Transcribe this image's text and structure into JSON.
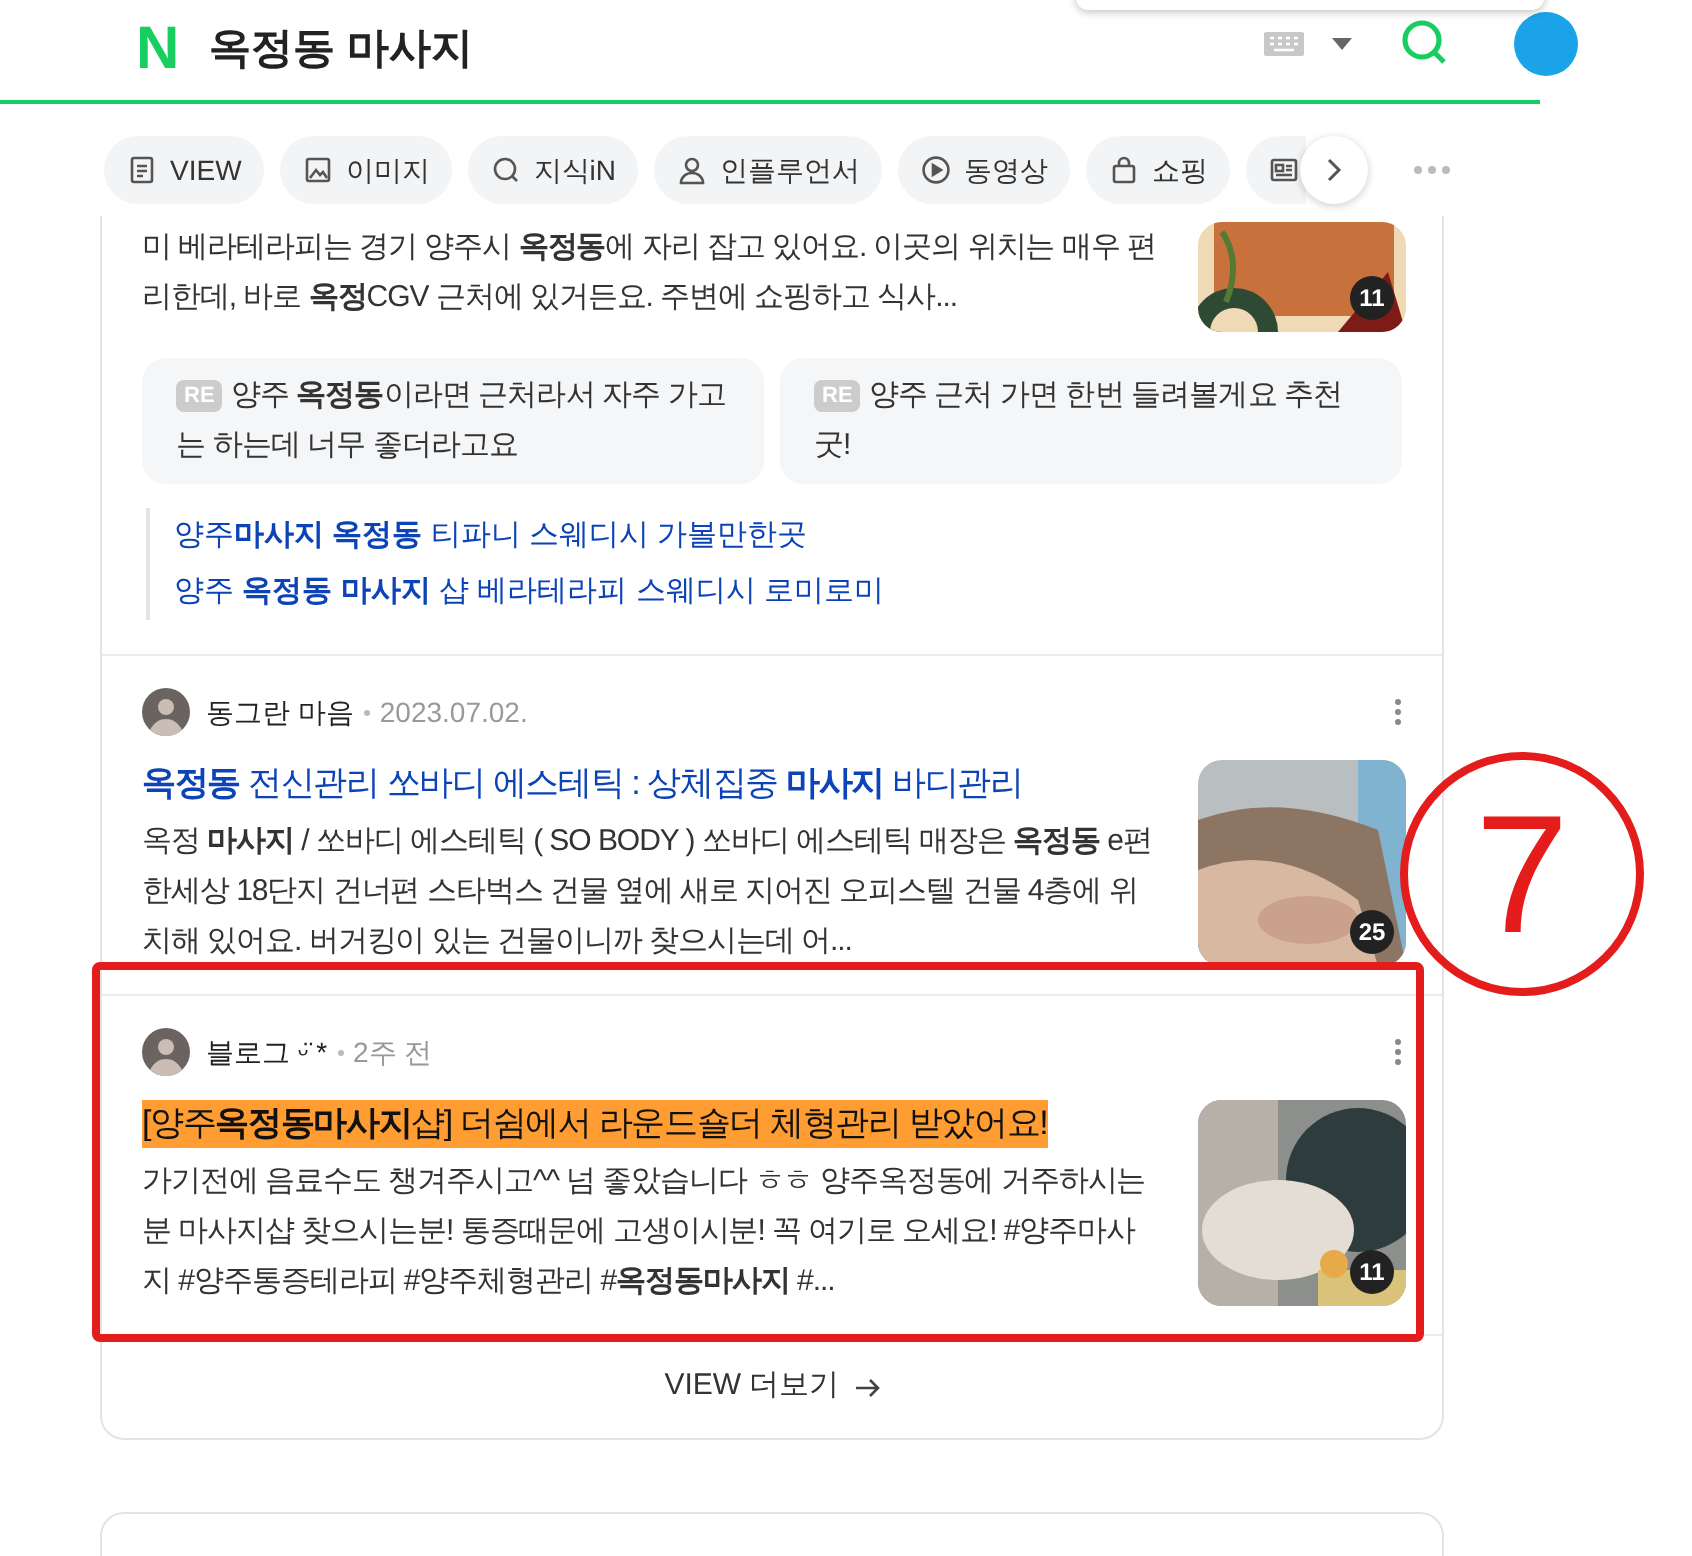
{
  "header": {
    "logo": "N",
    "query": "옥정동 마사지"
  },
  "tabs": [
    {
      "kind": "labeled",
      "label": "VIEW"
    },
    {
      "kind": "labeled",
      "label": "이미지"
    },
    {
      "kind": "labeled",
      "label": "지식iN"
    },
    {
      "kind": "labeled",
      "label": "인플루언서"
    },
    {
      "kind": "labeled",
      "label": "동영상"
    },
    {
      "kind": "labeled",
      "label": "쇼핑"
    },
    {
      "kind": "icon_only"
    }
  ],
  "posts": [
    {
      "snippet": "미 베라테라피는 경기 양주시 **옥정동**에 자리 잡고 있어요. 이곳의 위치는 매우 편리한데, 바로 **옥정**CGV 근처에 있거든요. 주변에 쇼핑하고 식사...",
      "thumb_count": "11",
      "comments": [
        {
          "tag": "RE",
          "text": "양주 **옥정동**이라면 근처라서 자주 가고는 하는데 너무 좋더라고요"
        },
        {
          "tag": "RE",
          "text": "양주 근처 가면 한번 들려볼게요 추천굿!"
        }
      ],
      "related": [
        "양주**마사지 옥정동** 티파니 스웨디시 가볼만한곳",
        "양주 **옥정동 마사지** 샵 베라테라피 스웨디시 로미로미"
      ]
    },
    {
      "author": "동그란 마음",
      "date": "2023.07.02.",
      "title": "**옥정동** 전신관리 쏘바디 에스테틱 : 상체집중 **마사지** 바디관리",
      "highlighted": false,
      "snippet": "옥정 **마사지** / 쏘바디 에스테틱 ( SO BODY ) 쏘바디 에스테틱 매장은 **옥정동** e편한세상 18단지 건너편 스타벅스 건물 옆에 새로 지어진 오피스텔 건물 4층에 위치해 있어요. 버거킹이 있는 건물이니까 찾으시는데 어...",
      "thumb_count": "25"
    },
    {
      "author": "블로그 ᵕ̈ *",
      "date": "2주 전",
      "title": "[양주**옥정동마사지**샵] 더쉼에서 라운드숄더 체형관리 받았어요!",
      "highlighted": true,
      "snippet": "가기전에 음료수도 챙겨주시고^^ 넘 좋았습니다 ㅎㅎ 양주옥정동에 거주하시는분 마사지샵 찾으시는분! 통증때문에 고생이시분! 꼭 여기로 오세요! #양주마사지 #양주통증테라피 #양주체형관리 #**옥정동마사지** #...",
      "thumb_count": "11"
    }
  ],
  "more_link": "VIEW 더보기",
  "annotation": {
    "label": "7"
  }
}
